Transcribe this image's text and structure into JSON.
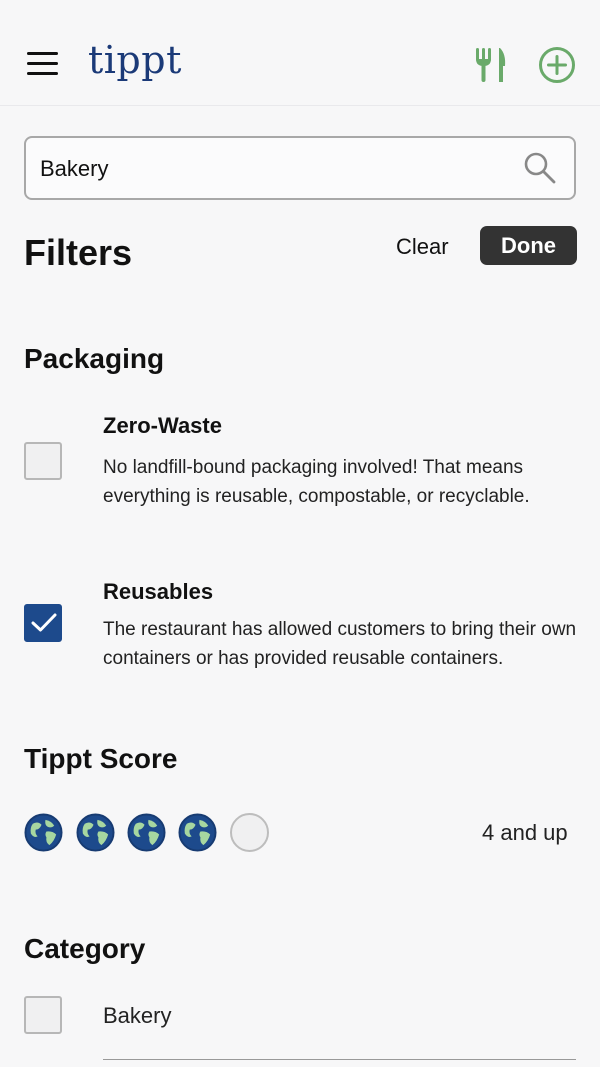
{
  "header": {
    "logo": "tippt",
    "menu_icon": "hamburger-menu-icon",
    "restaurant_icon": "fork-knife-icon",
    "add_icon": "add-circle-icon",
    "accent_color": "#6aaa6a",
    "brand_color": "#1b3a78"
  },
  "search": {
    "value": "Bakery",
    "placeholder": "",
    "icon": "search-icon"
  },
  "filters": {
    "title": "Filters",
    "clear_label": "Clear",
    "done_label": "Done"
  },
  "packaging": {
    "title": "Packaging",
    "options": [
      {
        "label": "Zero-Waste",
        "description": "No landfill-bound packaging involved! That means everything is reusable, compostable, or recyclable.",
        "checked": false
      },
      {
        "label": "Reusables",
        "description": "The restaurant has allowed customers to bring their own containers or has provided reusable containers.",
        "checked": true
      }
    ],
    "checked_color": "#1d4a8c"
  },
  "tippt_score": {
    "title": "Tippt Score",
    "rating": 4,
    "max": 5,
    "icon": "globe-icon",
    "summary": "4 and up"
  },
  "category": {
    "title": "Category",
    "items": [
      {
        "label": "Bakery",
        "checked": false
      }
    ]
  }
}
